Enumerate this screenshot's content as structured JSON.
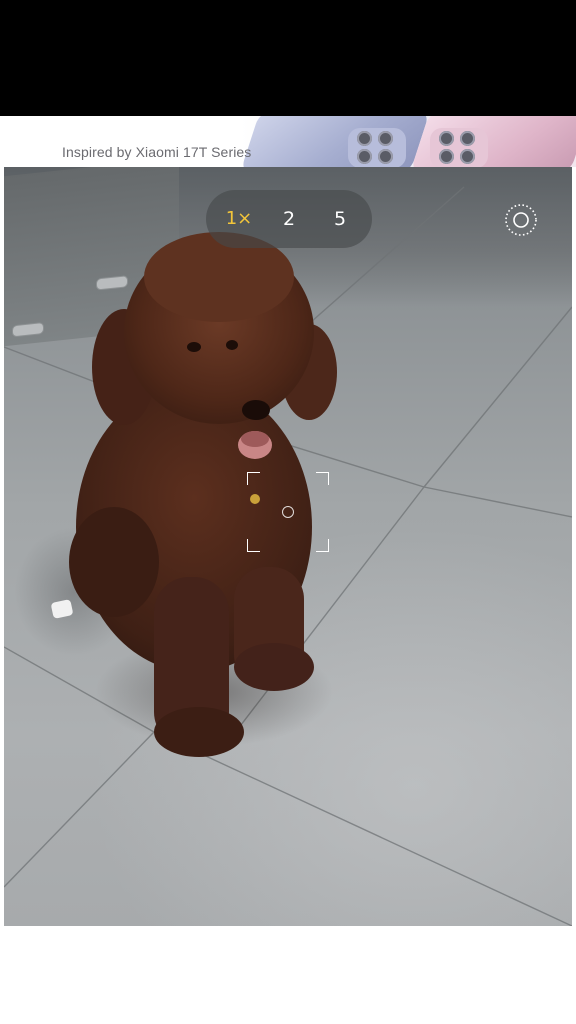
{
  "banner": {
    "text": "Inspired by Xiaomi 17T Series"
  },
  "camera": {
    "zoom_options": [
      "1×",
      "2",
      "5"
    ],
    "active_zoom": "1×"
  },
  "icons": {
    "settings": "settings-ring-icon",
    "focus_point": "focus-reticle-icon"
  },
  "colors": {
    "accent": "#f2c53a",
    "top_bar": "#000000",
    "zoom_pill": "#46484a"
  }
}
